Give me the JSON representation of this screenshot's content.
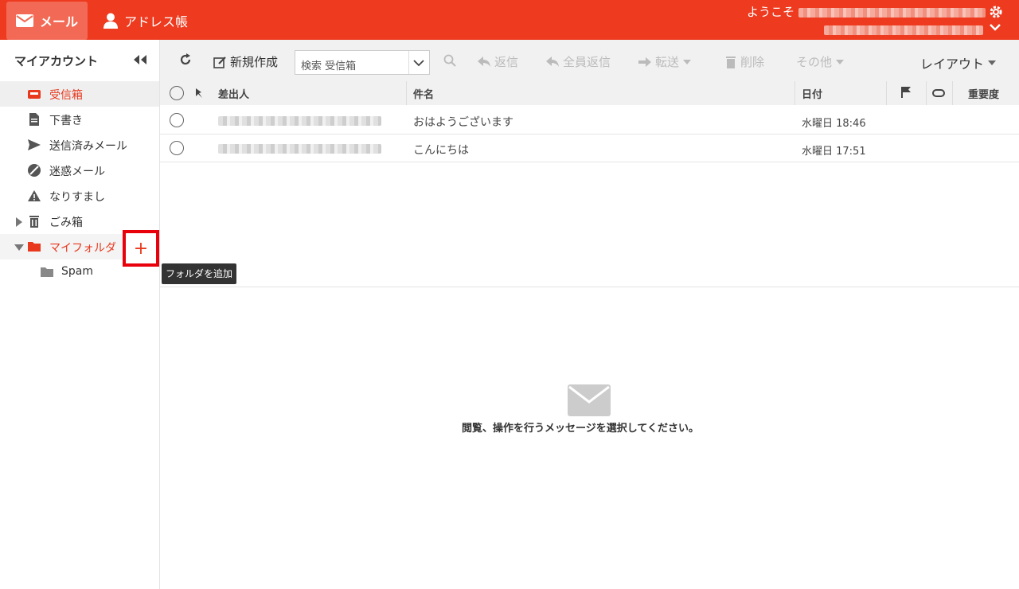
{
  "header": {
    "mail_tab": "メール",
    "address_tab": "アドレス帳",
    "welcome": "ようこそ"
  },
  "sidebar": {
    "title": "マイアカウント",
    "folders": [
      "受信箱",
      "下書き",
      "送信済みメール",
      "迷惑メール",
      "なりすまし",
      "ごみ箱",
      "マイフォルダ",
      "Spam"
    ],
    "add_tooltip": "フォルダを追加"
  },
  "toolbar": {
    "compose": "新規作成",
    "search_placeholder": "検索 受信箱",
    "reply": "返信",
    "reply_all": "全員返信",
    "forward": "転送",
    "delete": "削除",
    "more": "その他",
    "layout": "レイアウト"
  },
  "list": {
    "columns": {
      "from": "差出人",
      "subject": "件名",
      "date": "日付",
      "priority": "重要度"
    },
    "messages": [
      {
        "subject": "おはようございます",
        "date": "水曜日 18:46"
      },
      {
        "subject": "こんにちは",
        "date": "水曜日 17:51"
      }
    ]
  },
  "preview": {
    "empty_message": "閲覧、操作を行うメッセージを選択してください。"
  },
  "colors": {
    "brand": "#ee3a1f",
    "accent_text": "#e8391e",
    "highlight_box": "#e8000b"
  }
}
